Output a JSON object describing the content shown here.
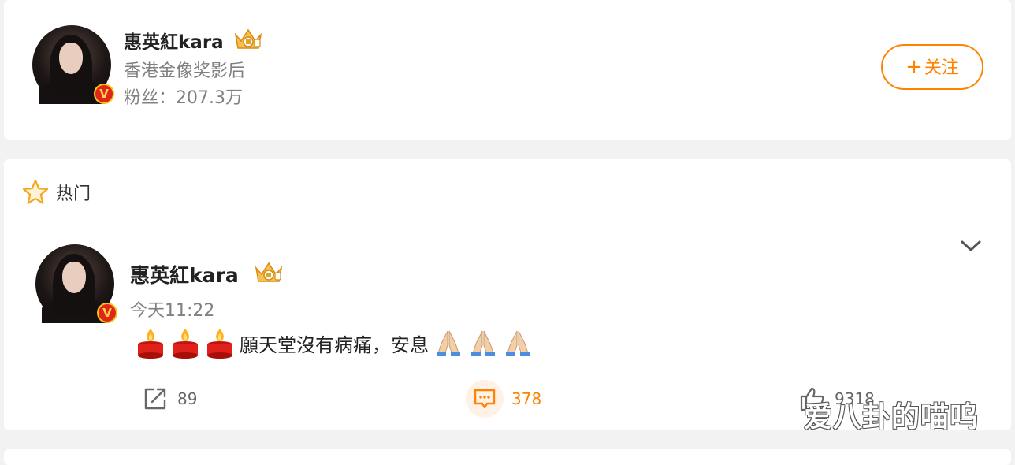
{
  "profile": {
    "name": "惠英紅kara",
    "title": "香港金像奖影后",
    "followers": "粉丝：207.3万",
    "follow_label": "关注",
    "follow_plus": "+"
  },
  "hot_section": {
    "label": "热门"
  },
  "post": {
    "author": "惠英紅kara",
    "time": "今天11:22",
    "text": "願天堂沒有病痛，安息",
    "leading_emoji": [
      "candle",
      "candle",
      "candle"
    ],
    "trailing_emoji": [
      "folded-hands",
      "folded-hands",
      "folded-hands"
    ],
    "reposts": "89",
    "comments": "378",
    "likes": "9318"
  },
  "watermark": "爱八卦的喵呜",
  "colors": {
    "accent": "#ff8200",
    "background": "#f2f2f2",
    "verified_red": "#e0251b",
    "verified_gold": "#f5c518"
  }
}
